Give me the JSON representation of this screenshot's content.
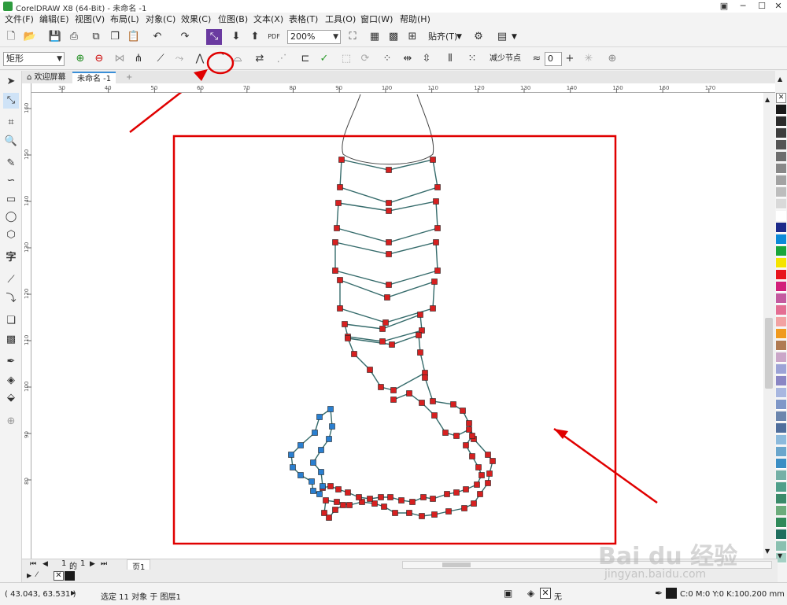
{
  "window": {
    "title": "CorelDRAW X8 (64-Bit) - 未命名 -1",
    "minimize": "─",
    "maximize": "☐",
    "close": "✕"
  },
  "menu": [
    "文件(F)",
    "编辑(E)",
    "视图(V)",
    "布局(L)",
    "对象(C)",
    "效果(C)",
    "位图(B)",
    "文本(X)",
    "表格(T)",
    "工具(O)",
    "窗口(W)",
    "帮助(H)"
  ],
  "toolbar": {
    "zoom": "200%",
    "snap": "贴齐(T)"
  },
  "property_bar": {
    "selection_mode": "矩形",
    "reduce_nodes": "减少节点",
    "smoothness": "0"
  },
  "doc_tabs": {
    "welcome": "欢迎屏幕",
    "document": "未命名 -1"
  },
  "ruler": {
    "h_ticks": [
      "30",
      "40",
      "50",
      "60",
      "70",
      "80",
      "90",
      "100",
      "110",
      "120",
      "130",
      "140",
      "150",
      "160",
      "170"
    ],
    "v_ticks": [
      "160",
      "150",
      "140",
      "130",
      "120",
      "110",
      "100",
      "90",
      "80"
    ]
  },
  "page_nav": {
    "current": "1",
    "of_label": "的",
    "total": "1",
    "page_tab": "页1"
  },
  "status": {
    "coords": "( 43.043, 63.531 )",
    "selection": "选定 11 对象 于 图层1",
    "fill_none": "无",
    "outline_color": "C:0 M:0 Y:0 K:100",
    "outline_width": ".200 mm"
  },
  "watermark": {
    "logo_text": "Bai du 经验",
    "url": "jingyan.baidu.com"
  },
  "colors": {
    "accent_red": "#e00000",
    "node_red": "#d62020",
    "node_blue": "#2a7fd0",
    "path": "#356b6b"
  }
}
